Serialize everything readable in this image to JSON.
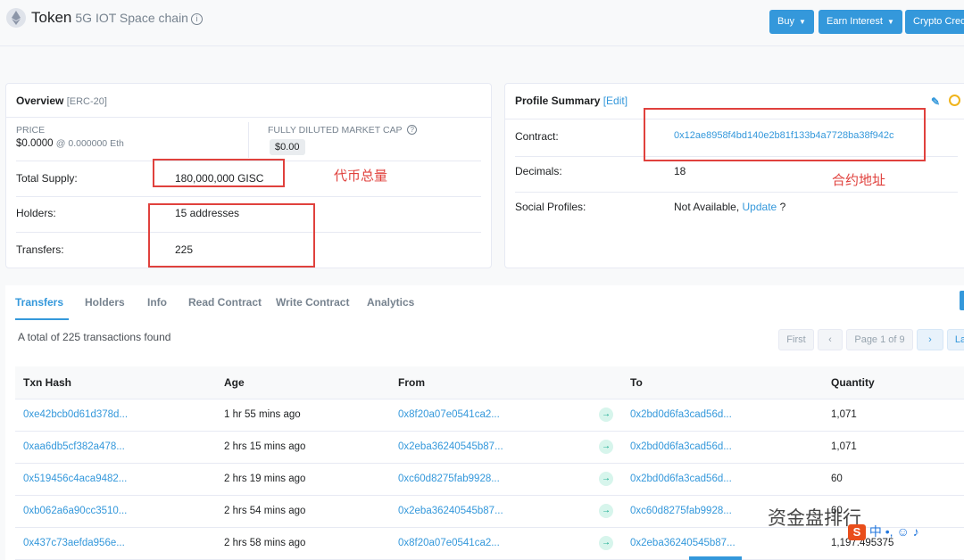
{
  "header": {
    "title": "Token",
    "subtitle": "5G IOT Space chain",
    "buttons": {
      "buy": "Buy",
      "earn": "Earn Interest",
      "crypto": "Crypto Cred"
    }
  },
  "overview": {
    "title": "Overview",
    "standard": "[ERC-20]",
    "price_label": "PRICE",
    "price_value": "$0.0000",
    "price_eth": "@ 0.000000 Eth",
    "mcap_label": "FULLY DILUTED MARKET CAP",
    "mcap_value": "$0.00",
    "total_supply_label": "Total Supply:",
    "total_supply_value": "180,000,000 GISC",
    "holders_label": "Holders:",
    "holders_value": "15 addresses",
    "transfers_label": "Transfers:",
    "transfers_value": "225"
  },
  "profile": {
    "title": "Profile Summary",
    "edit": "[Edit]",
    "contract_label": "Contract:",
    "contract_value": "0x12ae8958f4bd140e2b81f133b4a7728ba38f942c",
    "decimals_label": "Decimals:",
    "decimals_value": "18",
    "social_label": "Social Profiles:",
    "social_value": "Not Available,",
    "social_update": "Update",
    "social_q": "?"
  },
  "annotations": {
    "supply_note": "代币总量",
    "contract_note": "合约地址"
  },
  "tabs": [
    "Transfers",
    "Holders",
    "Info",
    "Read Contract",
    "Write Contract",
    "Analytics"
  ],
  "summary_text": "A total of 225 transactions found",
  "pagination": {
    "first": "First",
    "prev": "‹",
    "page": "Page 1 of 9",
    "next": "›",
    "last": "La"
  },
  "table": {
    "headers": [
      "Txn Hash",
      "Age",
      "From",
      "",
      "To",
      "Quantity"
    ],
    "rows": [
      {
        "hash": "0xe42bcb0d61d378d...",
        "age": "1 hr 55 mins ago",
        "from": "0x8f20a07e0541ca2...",
        "to": "0x2bd0d6fa3cad56d...",
        "qty": "1,071"
      },
      {
        "hash": "0xaa6db5cf382a478...",
        "age": "2 hrs 15 mins ago",
        "from": "0x2eba36240545b87...",
        "to": "0x2bd0d6fa3cad56d...",
        "qty": "1,071"
      },
      {
        "hash": "0x519456c4aca9482...",
        "age": "2 hrs 19 mins ago",
        "from": "0xc60d8275fab9928...",
        "to": "0x2bd0d6fa3cad56d...",
        "qty": "60"
      },
      {
        "hash": "0xb062a6a90cc3510...",
        "age": "2 hrs 54 mins ago",
        "from": "0x2eba36240545b87...",
        "to": "0xc60d8275fab9928...",
        "qty": "60"
      },
      {
        "hash": "0x437c73aefda956e...",
        "age": "2 hrs 58 mins ago",
        "from": "0x8f20a07e0541ca2...",
        "to": "0x2eba36240545b87...",
        "qty": "1,197.495375"
      }
    ]
  },
  "watermark": "资金盘排行",
  "ime_text": "中 •, ☺ ♪"
}
